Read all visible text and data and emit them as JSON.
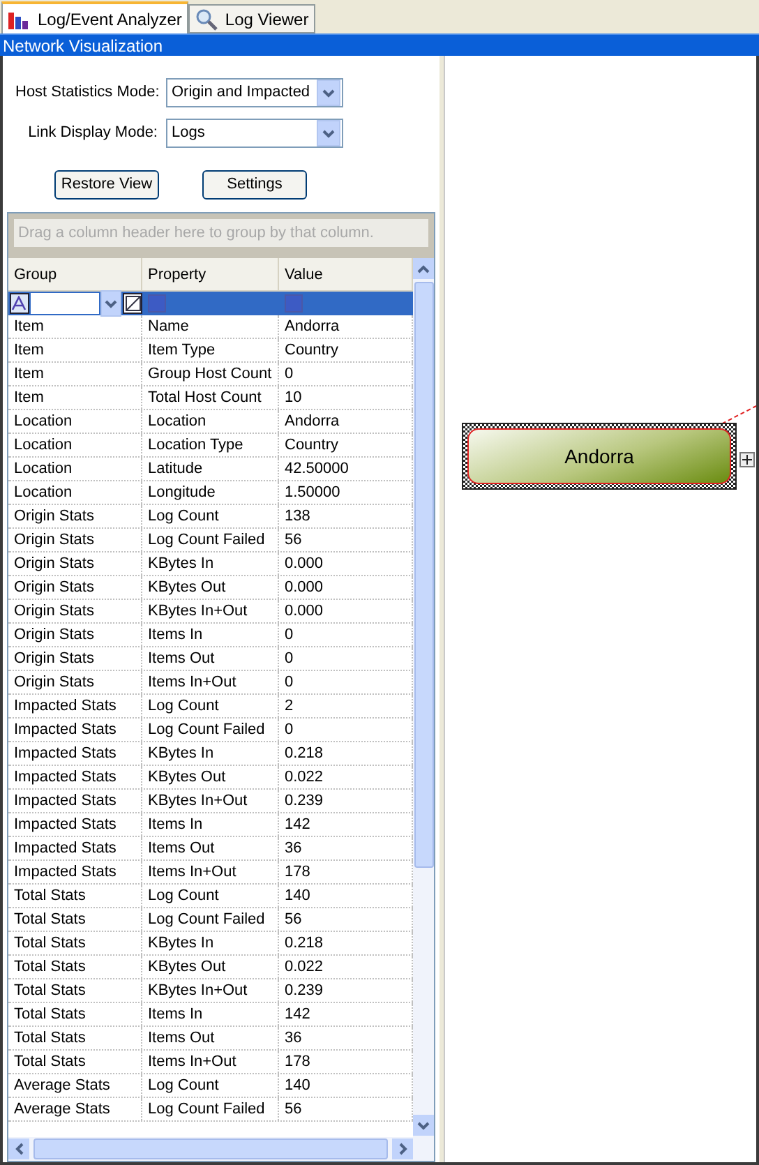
{
  "tabs": [
    {
      "label": "Log/Event Analyzer",
      "selected": true
    },
    {
      "label": "Log Viewer",
      "selected": false
    }
  ],
  "panel_title": "Network Visualization",
  "host_statistics_mode": {
    "label": "Host Statistics Mode:",
    "value": "Origin and Impacted"
  },
  "link_display_mode": {
    "label": "Link Display Mode:",
    "value": "Logs"
  },
  "buttons": [
    "Restore View",
    "Settings"
  ],
  "grid": {
    "group_panel_hint": "Drag a column header here to group by that column.",
    "columns": [
      "Group",
      "Property",
      "Value"
    ],
    "rows": [
      [
        "Item",
        "Name",
        "Andorra"
      ],
      [
        "Item",
        "Item Type",
        "Country"
      ],
      [
        "Item",
        "Group Host Count",
        "0"
      ],
      [
        "Item",
        "Total Host Count",
        "10"
      ],
      [
        "Location",
        "Location",
        "Andorra"
      ],
      [
        "Location",
        "Location Type",
        "Country"
      ],
      [
        "Location",
        "Latitude",
        "42.50000"
      ],
      [
        "Location",
        "Longitude",
        "1.50000"
      ],
      [
        "Origin Stats",
        "Log Count",
        "138"
      ],
      [
        "Origin Stats",
        "Log Count Failed",
        "56"
      ],
      [
        "Origin Stats",
        "KBytes In",
        "0.000"
      ],
      [
        "Origin Stats",
        "KBytes Out",
        "0.000"
      ],
      [
        "Origin Stats",
        "KBytes In+Out",
        "0.000"
      ],
      [
        "Origin Stats",
        "Items In",
        "0"
      ],
      [
        "Origin Stats",
        "Items Out",
        "0"
      ],
      [
        "Origin Stats",
        "Items In+Out",
        "0"
      ],
      [
        "Impacted Stats",
        "Log Count",
        "2"
      ],
      [
        "Impacted Stats",
        "Log Count Failed",
        "0"
      ],
      [
        "Impacted Stats",
        "KBytes In",
        "0.218"
      ],
      [
        "Impacted Stats",
        "KBytes Out",
        "0.022"
      ],
      [
        "Impacted Stats",
        "KBytes In+Out",
        "0.239"
      ],
      [
        "Impacted Stats",
        "Items In",
        "142"
      ],
      [
        "Impacted Stats",
        "Items Out",
        "36"
      ],
      [
        "Impacted Stats",
        "Items In+Out",
        "178"
      ],
      [
        "Total Stats",
        "Log Count",
        "140"
      ],
      [
        "Total Stats",
        "Log Count Failed",
        "56"
      ],
      [
        "Total Stats",
        "KBytes In",
        "0.218"
      ],
      [
        "Total Stats",
        "KBytes Out",
        "0.022"
      ],
      [
        "Total Stats",
        "KBytes In+Out",
        "0.239"
      ],
      [
        "Total Stats",
        "Items In",
        "142"
      ],
      [
        "Total Stats",
        "Items Out",
        "36"
      ],
      [
        "Total Stats",
        "Items In+Out",
        "178"
      ],
      [
        "Average Stats",
        "Log Count",
        "140"
      ],
      [
        "Average Stats",
        "Log Count Failed",
        "56"
      ]
    ]
  },
  "node": {
    "label": "Andorra"
  }
}
